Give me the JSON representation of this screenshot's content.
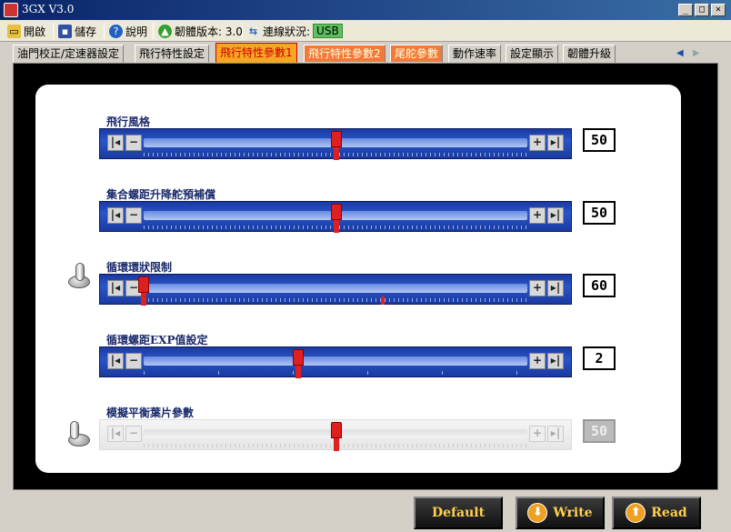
{
  "window": {
    "title": "3GX  V3.0"
  },
  "toolbar": {
    "open_label": "開啟",
    "save_label": "儲存",
    "help_label": "說明",
    "firmware_label": "韌體版本: 3.0",
    "connection_label": "連線狀況:",
    "connection_status": "USB"
  },
  "tabs": [
    {
      "label": "油門校正/定速器設定"
    },
    {
      "label": "飛行特性設定"
    },
    {
      "label": "飛行特性參數1"
    },
    {
      "label": "飛行特性參數2"
    },
    {
      "label": "尾舵參數"
    },
    {
      "label": "動作速率"
    },
    {
      "label": "設定顯示"
    },
    {
      "label": "韌體升級"
    }
  ],
  "sliders": [
    {
      "label": "飛行風格",
      "value": "50",
      "position_fraction": 0.5,
      "enabled": true
    },
    {
      "label": "集合螺距升降舵預補償",
      "value": "50",
      "position_fraction": 0.5,
      "enabled": true
    },
    {
      "label": "循環環狀限制",
      "value": "60",
      "position_fraction": 0.0,
      "marker_fraction": 0.62,
      "enabled": true,
      "has_toggle": true
    },
    {
      "label": "循環螺距EXP值設定",
      "value": "2",
      "position_fraction": 0.4,
      "enabled": true
    },
    {
      "label": "模擬平衡葉片參數",
      "value": "50",
      "position_fraction": 0.5,
      "enabled": false,
      "has_toggle": true
    }
  ],
  "buttons": {
    "default_label": "Default",
    "write_label": "Write",
    "read_label": "Read"
  },
  "colors": {
    "active_tab": "#f5a623",
    "slider_blue": "#2a55c8",
    "thumb_red": "#e02020",
    "button_text": "#ffd050"
  }
}
